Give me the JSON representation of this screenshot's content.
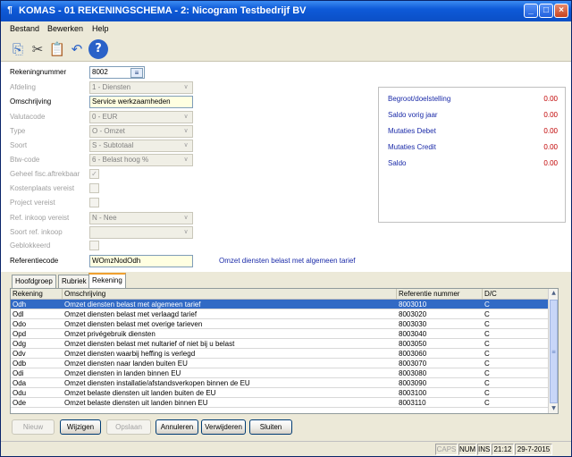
{
  "window": {
    "title": "KOMAS - 01 REKENINGSCHEMA - 2: Nicogram Testbedrijf BV",
    "minimize": "_",
    "maximize": "□",
    "close": "×",
    "app_icon": "¶"
  },
  "menu": [
    "Bestand",
    "Bewerken",
    "Help"
  ],
  "toolbar": {
    "icons": [
      "copy-icon",
      "cut-icon",
      "paste-icon",
      "undo-icon",
      "help-icon"
    ],
    "glyphs": [
      "⎘",
      "✂",
      "📋",
      "↶",
      "?"
    ]
  },
  "form": {
    "rekeningnummer": {
      "label": "Rekeningnummer",
      "value": "8002"
    },
    "afdeling": {
      "label": "Afdeling",
      "value": "1 - Diensten"
    },
    "omschrijving": {
      "label": "Omschrijving",
      "value": "Service werkzaamheden"
    },
    "valutacode": {
      "label": "Valutacode",
      "value": "0 - EUR"
    },
    "type": {
      "label": "Type",
      "value": "O - Omzet"
    },
    "soort": {
      "label": "Soort",
      "value": "S - Subtotaal"
    },
    "btwcode": {
      "label": "Btw-code",
      "value": "6 - Belast hoog %"
    },
    "geheel_fisc": {
      "label": "Geheel fisc.aftrekbaar",
      "checked": "✓"
    },
    "kostenplaats": {
      "label": "Kostenplaats vereist"
    },
    "project": {
      "label": "Project vereist"
    },
    "ref_inkoop": {
      "label": "Ref. inkoop vereist",
      "value": "N - Nee"
    },
    "soort_ref_inkoop": {
      "label": "Soort ref. inkoop",
      "value": ""
    },
    "geblokkeerd": {
      "label": "Geblokkeerd"
    },
    "referentiecode": {
      "label": "Referentiecode",
      "value": "WOmzNodOdh"
    },
    "referentie_omschrijving": "Omzet diensten belast met algemeen tarief"
  },
  "summary": [
    {
      "label": "Begroot/doelstelling",
      "value": "0.00"
    },
    {
      "label": "Saldo vorig jaar",
      "value": "0.00"
    },
    {
      "label": "Mutaties Debet",
      "value": "0.00"
    },
    {
      "label": "Mutaties Credit",
      "value": "0.00"
    },
    {
      "label": "Saldo",
      "value": "0.00"
    }
  ],
  "tabs": [
    "Hoofdgroep",
    "Rubriek",
    "Rekening"
  ],
  "grid": {
    "columns": [
      "Rekening",
      "Omschrijving",
      "Referentie nummer",
      "D/C"
    ],
    "rows": [
      [
        "Odh",
        "Omzet diensten belast met algemeen tarief",
        "8003010",
        "C"
      ],
      [
        "Odl",
        "Omzet diensten belast met verlaagd tarief",
        "8003020",
        "C"
      ],
      [
        "Odo",
        "Omzet diensten belast met overige tarieven",
        "8003030",
        "C"
      ],
      [
        "Opd",
        "Omzet privégebruik diensten",
        "8003040",
        "C"
      ],
      [
        "Odg",
        "Omzet diensten belast met nultarief of niet bij u belast",
        "8003050",
        "C"
      ],
      [
        "Odv",
        "Omzet diensten waarbij heffing is verlegd",
        "8003060",
        "C"
      ],
      [
        "Odb",
        "Omzet diensten naar landen buiten EU",
        "8003070",
        "C"
      ],
      [
        "Odi",
        "Omzet diensten in landen binnen EU",
        "8003080",
        "C"
      ],
      [
        "Oda",
        "Omzet diensten  installatie/afstandsverkopen binnen de EU",
        "8003090",
        "C"
      ],
      [
        "Odu",
        "Omzet belaste diensten uit landen buiten de EU",
        "8003100",
        "C"
      ],
      [
        "Ode",
        "Omzet belaste diensten uit landen binnen EU",
        "8003110",
        "C"
      ]
    ]
  },
  "buttons": [
    "Nieuw",
    "Wijzigen",
    "Opslaan",
    "Annuleren",
    "Verwijderen",
    "Sluiten"
  ],
  "status": {
    "caps": "CAPS",
    "num": "NUM",
    "ins": "INS",
    "time": "21:12",
    "date": "29-7-2015"
  },
  "colors": {
    "title_bar": "#0e5ad8",
    "selected_row": "#316ac5",
    "value_red": "#c00000",
    "label_blue": "#1a2aa8"
  }
}
